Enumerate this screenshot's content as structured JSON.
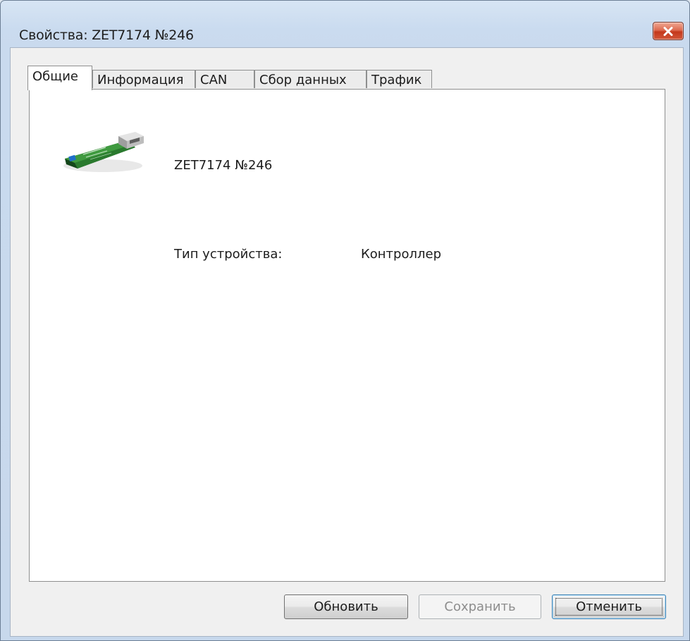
{
  "window": {
    "title": "Свойства: ZET7174 №246",
    "close_icon": "close-icon"
  },
  "tabs": [
    {
      "label": "Общие",
      "active": true
    },
    {
      "label": "Информация",
      "active": false
    },
    {
      "label": "CAN",
      "active": false
    },
    {
      "label": "Сбор данных",
      "active": false
    },
    {
      "label": "Трафик",
      "active": false
    }
  ],
  "general": {
    "device_icon": "usb-device-icon",
    "device_name": "ZET7174 №246",
    "device_type_label": "Тип устройства:",
    "device_type_value": "Контроллер"
  },
  "buttons": {
    "refresh": "Обновить",
    "save": "Сохранить",
    "cancel": "Отменить"
  },
  "colors": {
    "close_button": "#c4391c",
    "device_board": "#2e7d32",
    "default_button_border": "#3c7fb1"
  }
}
